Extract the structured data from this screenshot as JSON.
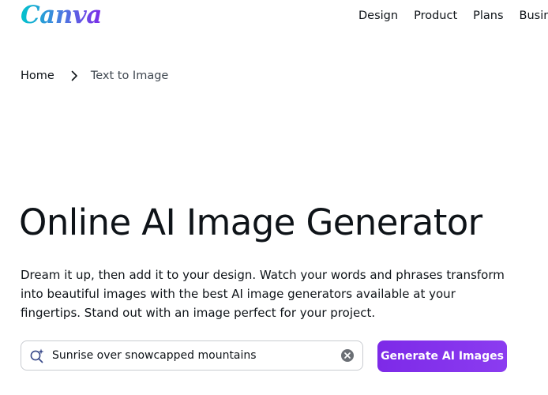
{
  "brand": {
    "logo_text": "Canva"
  },
  "nav": {
    "items": [
      {
        "label": "Design"
      },
      {
        "label": "Product"
      },
      {
        "label": "Plans"
      },
      {
        "label": "Business"
      }
    ]
  },
  "breadcrumb": {
    "home": "Home",
    "current": "Text to Image"
  },
  "hero": {
    "title": "Online AI Image Generator",
    "description": "Dream it up, then add it to your design. Watch your words and phrases transform into beautiful images with the best AI image generators available at your fingertips. Stand out with an image perfect for your project."
  },
  "prompt": {
    "value": "Sunrise over snowcapped mountains"
  },
  "cta": {
    "label": "Generate AI Images"
  },
  "icons": {
    "search": "sparkle-search-icon",
    "clear": "clear-icon",
    "chevron": "chevron-right-icon"
  },
  "colors": {
    "brand_purple": "#7d2ae8",
    "brand_teal": "#00c4cc",
    "text": "#0e1318"
  }
}
